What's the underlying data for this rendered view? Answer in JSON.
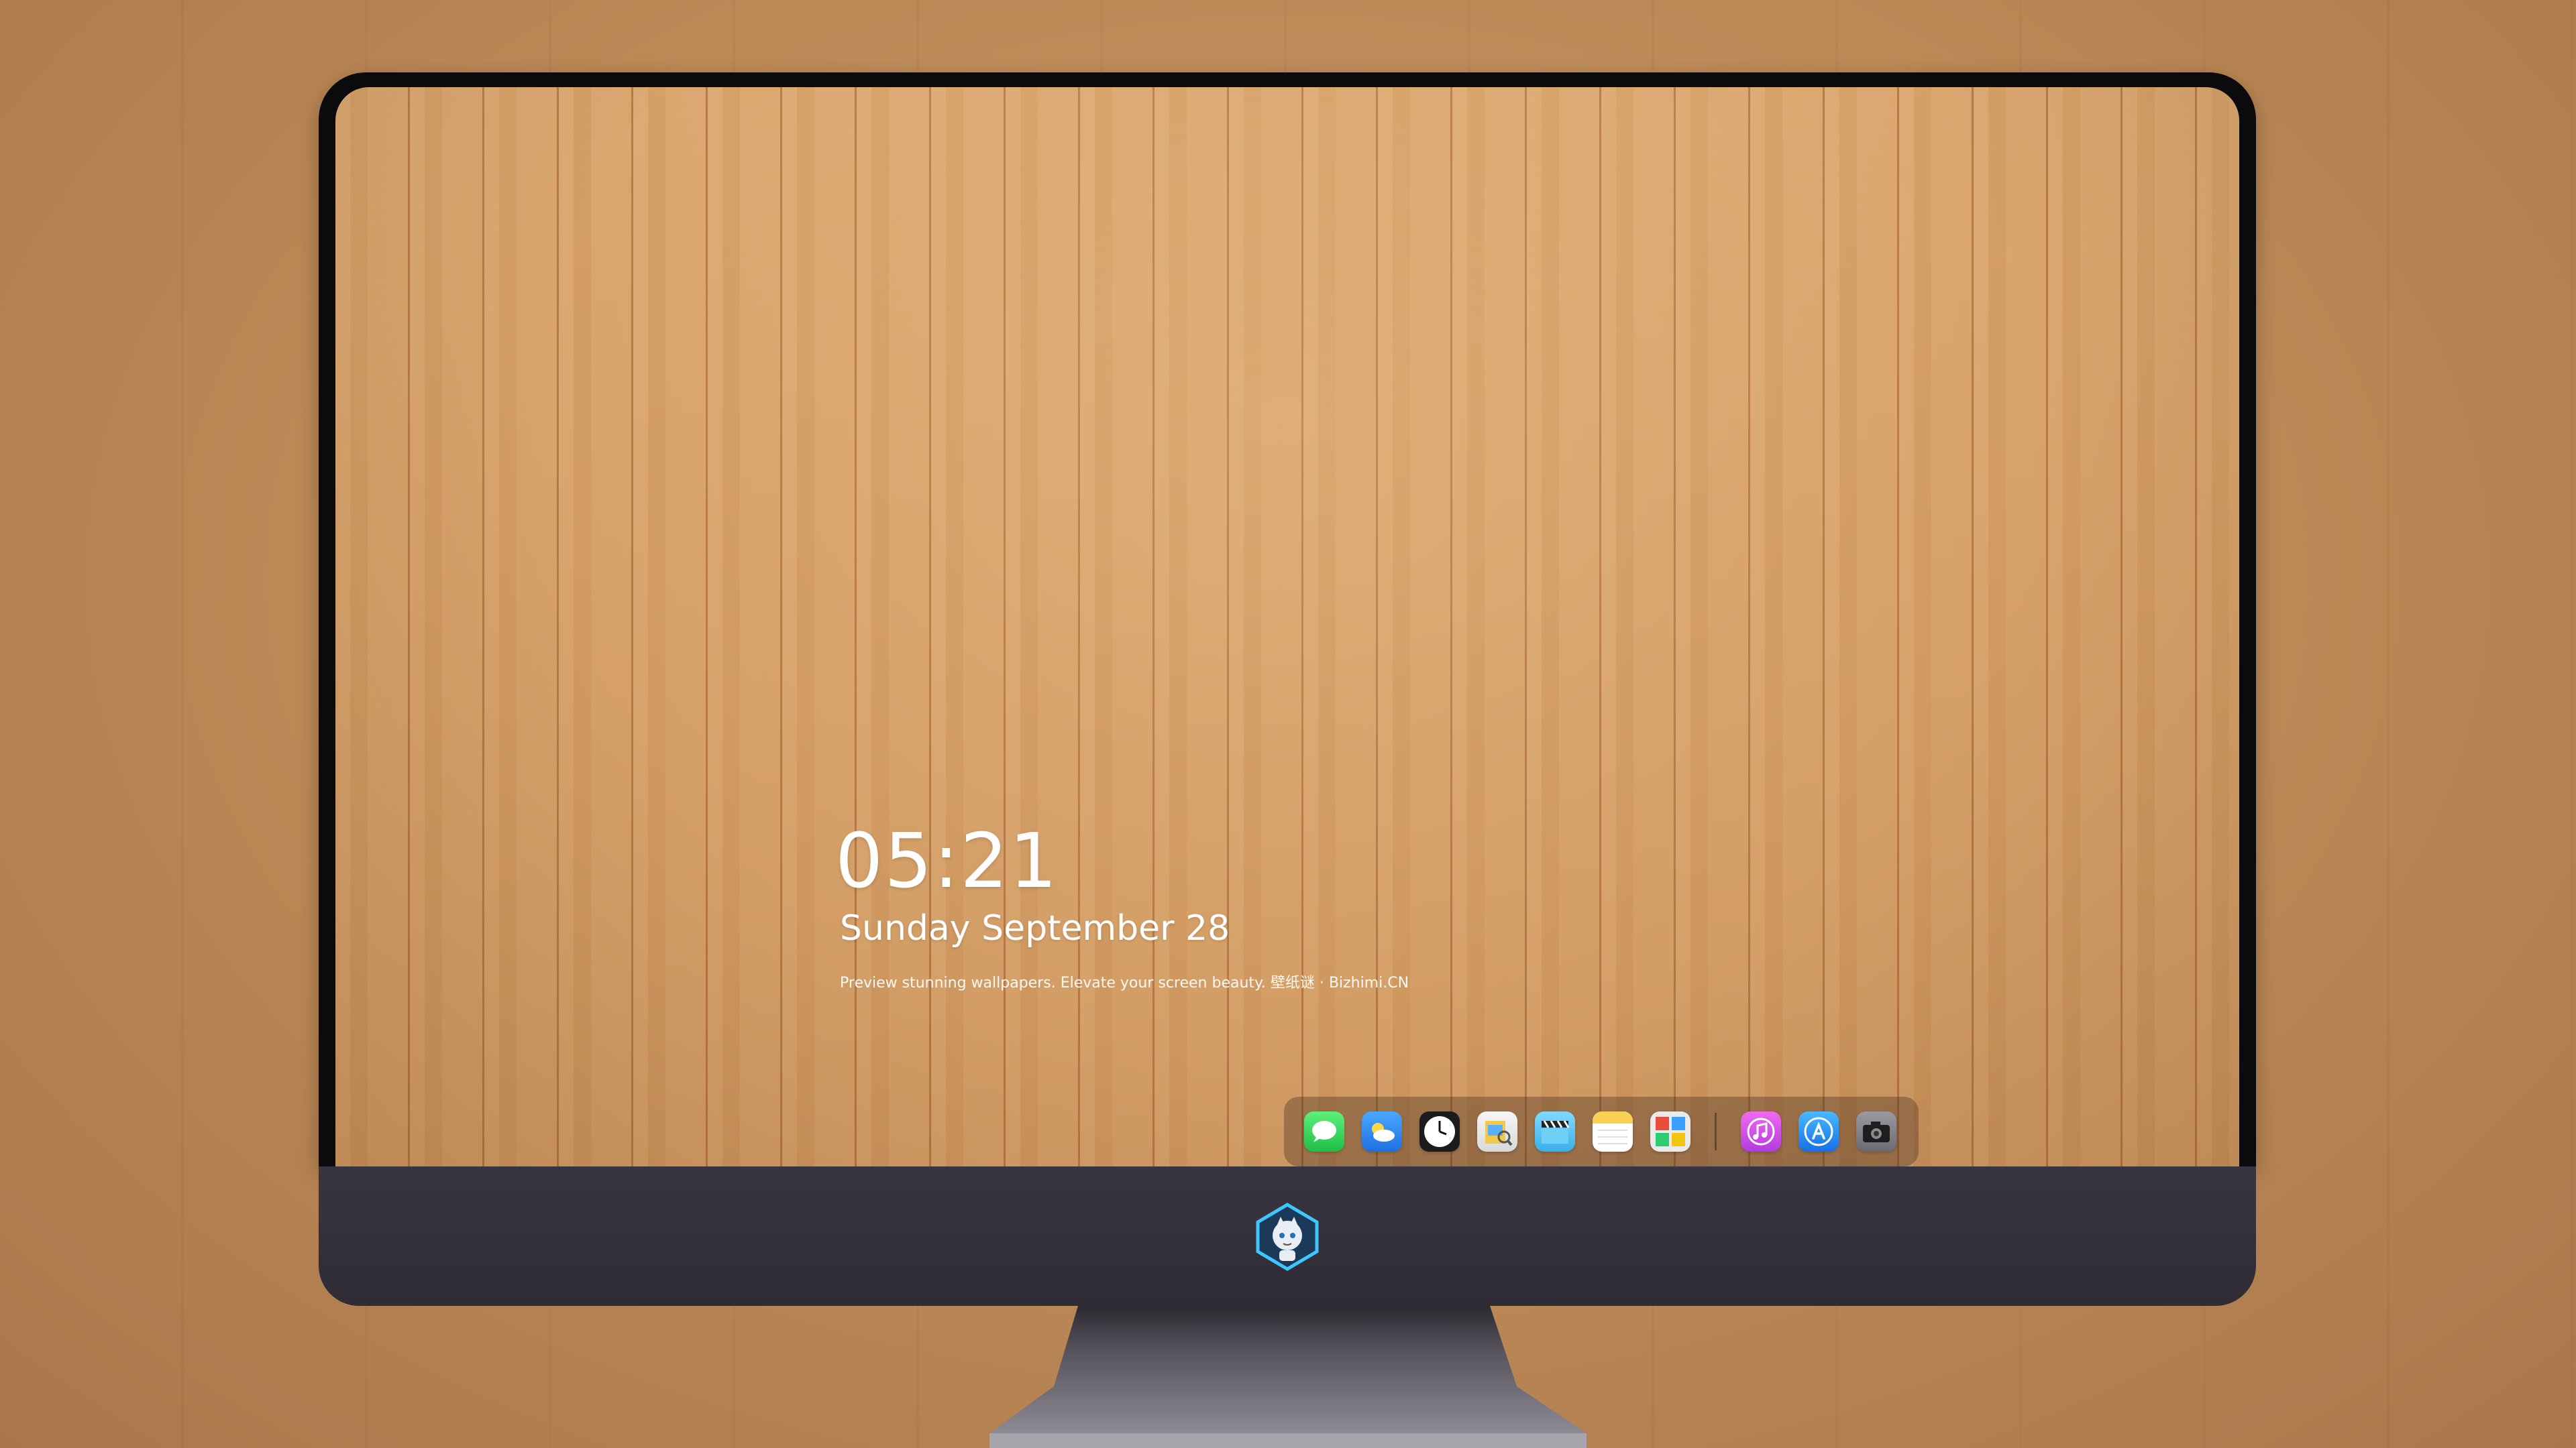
{
  "lockscreen": {
    "time": "05:21",
    "date": "Sunday September  28",
    "tagline": "Preview stunning wallpapers. Elevate your screen beauty. 壁纸谜 · Bizhimi.CN"
  },
  "dock": {
    "apps": [
      {
        "name": "messages-icon",
        "color": "#2fd158"
      },
      {
        "name": "weather-icon",
        "color": "#2e8cf0"
      },
      {
        "name": "clock-icon",
        "color": "#1c1c1e"
      },
      {
        "name": "preview-icon",
        "color": "#f2c94c"
      },
      {
        "name": "clips-icon",
        "color": "#5ac8fa"
      },
      {
        "name": "notes-icon",
        "color": "#f7d154"
      },
      {
        "name": "photo-booth-icon",
        "color": "#e0e0e0"
      },
      {
        "name": "itunes-icon",
        "color": "#d54ff0"
      },
      {
        "name": "app-store-icon",
        "color": "#1a8cff"
      },
      {
        "name": "camera-icon",
        "color": "#8e8e93"
      }
    ]
  },
  "colors": {
    "wood": "#d59f66",
    "bezel": "#0b0b0d",
    "chin": "#393540"
  }
}
